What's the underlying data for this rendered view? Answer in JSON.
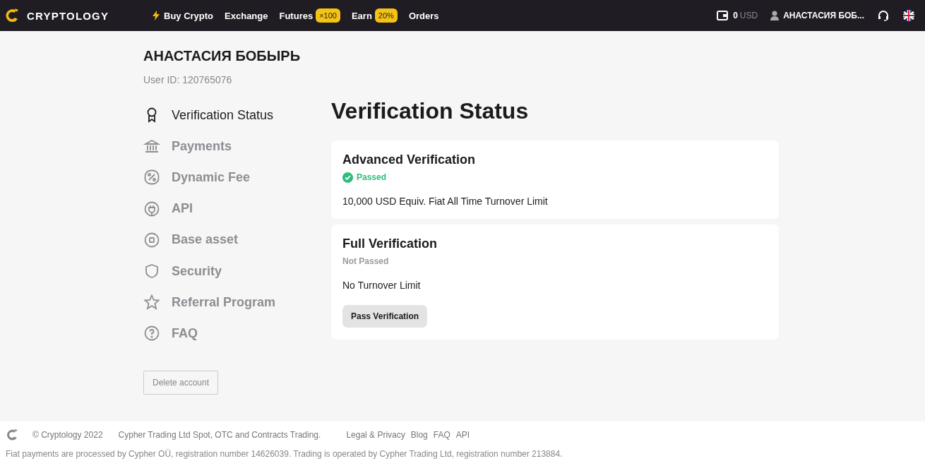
{
  "header": {
    "logo": "CRYPTOLOGY",
    "nav": [
      {
        "label": "Buy Crypto",
        "kind": "bolt"
      },
      {
        "label": "Exchange",
        "kind": "plain"
      },
      {
        "label": "Futures",
        "kind": "badge",
        "badge": "×100"
      },
      {
        "label": "Earn",
        "kind": "badge",
        "badge": "20%"
      },
      {
        "label": "Orders",
        "kind": "plain"
      }
    ],
    "balance": "0",
    "currency": "USD",
    "user": "АНАСТАСИЯ БОБ..."
  },
  "profile": {
    "name": "АНАСТАСИЯ БОБЫРЬ",
    "user_id": "User ID: 120765076"
  },
  "sidebar": {
    "items": [
      {
        "label": "Verification Status",
        "kind": "award",
        "selected": true
      },
      {
        "label": "Payments",
        "kind": "bank",
        "selected": false
      },
      {
        "label": "Dynamic Fee",
        "kind": "percent",
        "selected": false
      },
      {
        "label": "API",
        "kind": "plug",
        "selected": false
      },
      {
        "label": "Base asset",
        "kind": "coin",
        "selected": false
      },
      {
        "label": "Security",
        "kind": "shield",
        "selected": false
      },
      {
        "label": "Referral Program",
        "kind": "star",
        "selected": false
      },
      {
        "label": "FAQ",
        "kind": "help",
        "selected": false
      }
    ],
    "delete_button": "Delete account"
  },
  "main": {
    "title": "Verification Status",
    "cards": [
      {
        "title": "Advanced Verification",
        "status": "Passed",
        "passed": true,
        "limit": "10,000 USD Equiv. Fiat All Time Turnover Limit"
      },
      {
        "title": "Full Verification",
        "status": "Not Passed",
        "passed": false,
        "limit": "No Turnover Limit",
        "button": "Pass Verification"
      }
    ]
  },
  "footer": {
    "copyright": "© Cryptology 2022",
    "company": "Cypher Trading Ltd Spot, OTC and Contracts Trading.",
    "links": [
      "Legal & Privacy",
      "Blog",
      "FAQ",
      "API"
    ],
    "notice": "Fiat payments are processed by Cypher OÜ, registration number 14626039. Trading is operated by Cypher Trading Ltd, registration number 213884."
  }
}
